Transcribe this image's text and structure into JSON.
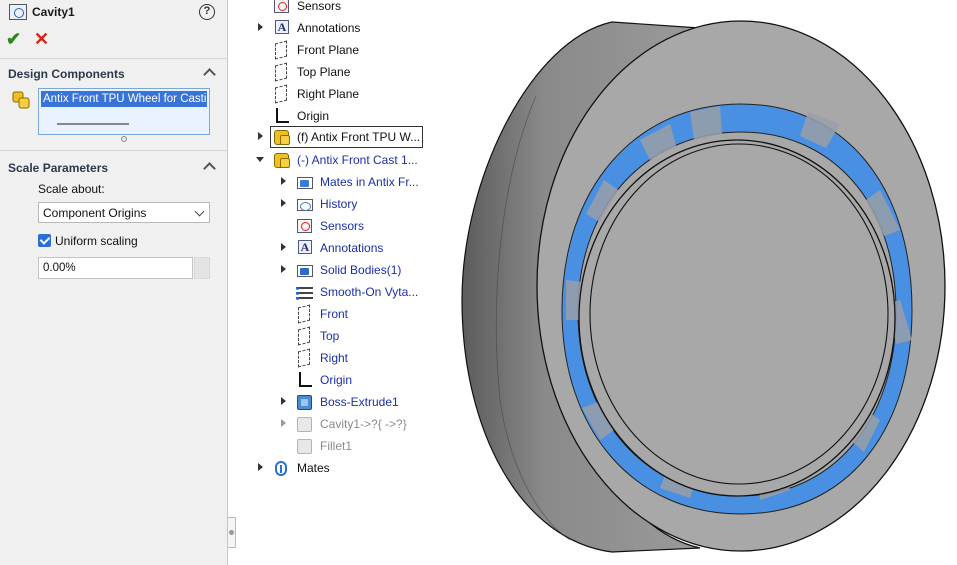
{
  "property_manager": {
    "title": "Cavity1",
    "help_label": "?",
    "ok_symbol": "✔",
    "cancel_symbol": "✕",
    "design_components": {
      "heading": "Design Components",
      "selected_item": "Antix Front TPU Wheel for Casting"
    },
    "scale_parameters": {
      "heading": "Scale Parameters",
      "scale_about_label": "Scale about:",
      "scale_about_value": "Component Origins",
      "uniform_scaling_label": "Uniform scaling",
      "uniform_scaling_checked": true,
      "scale_value": "0.00%"
    }
  },
  "tree": {
    "sensors": "Sensors",
    "annotations": "Annotations",
    "front_plane": "Front Plane",
    "top_plane": "Top Plane",
    "right_plane": "Right Plane",
    "origin": "Origin",
    "component_1": "(f) Antix Front TPU W...",
    "component_2": "(-) Antix Front Cast 1...",
    "children": {
      "mates_in": "Mates in Antix Fr...",
      "history": "History",
      "sensors": "Sensors",
      "annotations": "Annotations",
      "solid_bodies": "Solid Bodies(1)",
      "material": "Smooth-On Vyta...",
      "front": "Front",
      "top": "Top",
      "right": "Right",
      "origin": "Origin",
      "boss_extrude": "Boss-Extrude1",
      "cavity": "Cavity1->?{ ->?}",
      "fillet": "Fillet1"
    },
    "mates": "Mates"
  },
  "colors": {
    "selection_blue": "#3874d8",
    "tree_link_blue": "#1a2fa8",
    "wheel_gray": "#a8a8a8",
    "insert_blue": "#4a90e2"
  }
}
